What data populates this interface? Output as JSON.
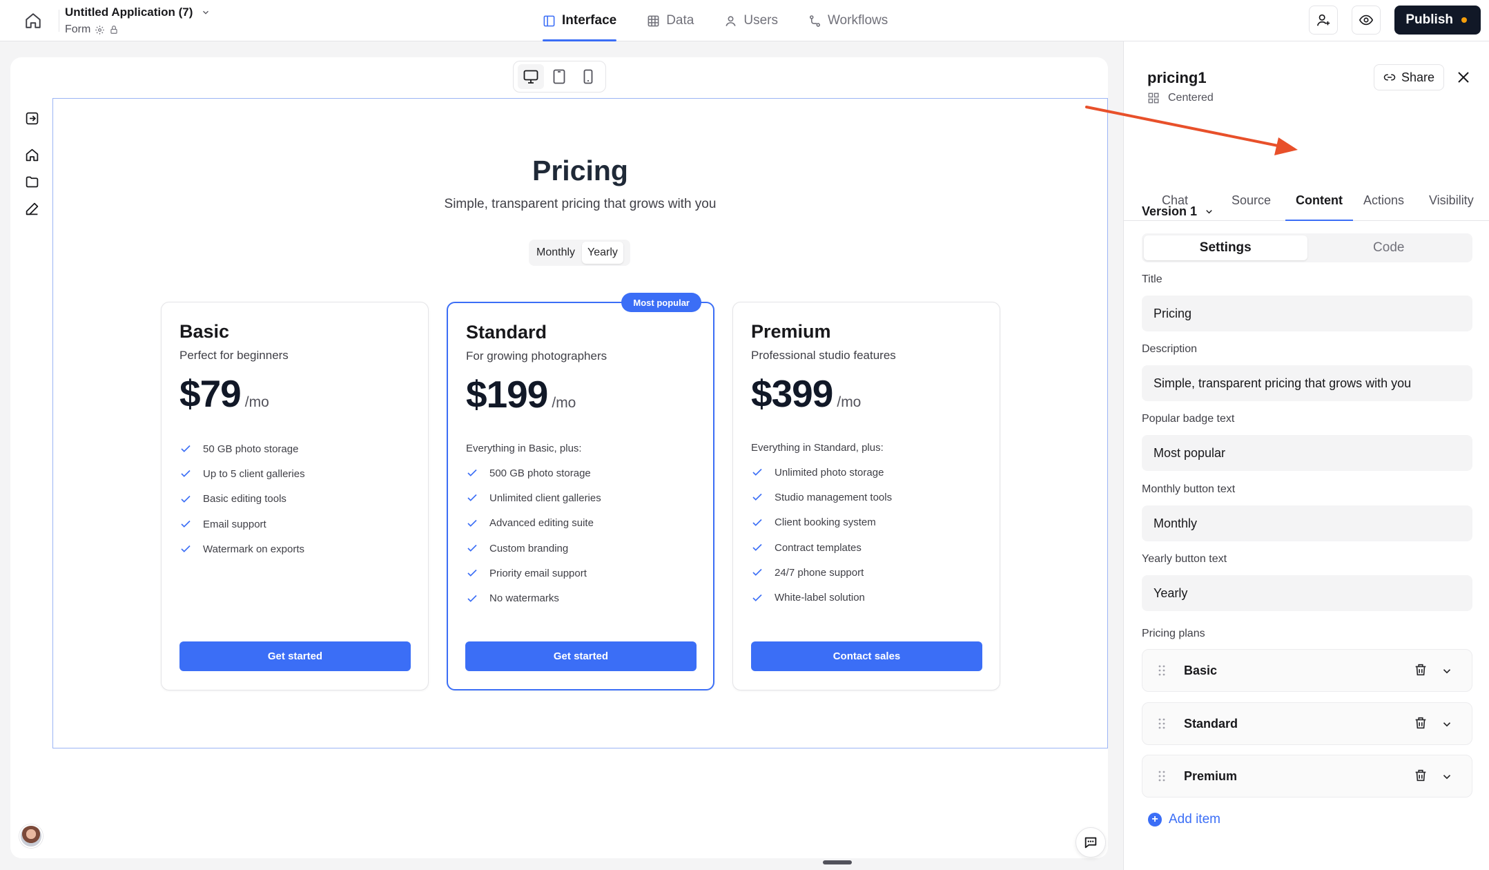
{
  "app": {
    "title": "Untitled Application (7)",
    "subtitle": "Form"
  },
  "nav": {
    "tabs": [
      {
        "label": "Interface",
        "icon": "layout-icon",
        "active": true
      },
      {
        "label": "Data",
        "icon": "table-icon",
        "active": false
      },
      {
        "label": "Users",
        "icon": "user-icon",
        "active": false
      },
      {
        "label": "Workflows",
        "icon": "workflow-icon",
        "active": false
      }
    ]
  },
  "toolbar": {
    "publish_label": "Publish",
    "publish_status_color": "#f59e0b"
  },
  "preview": {
    "devices": [
      "desktop",
      "tablet",
      "mobile"
    ],
    "active_device": "desktop"
  },
  "pricing": {
    "title": "Pricing",
    "description": "Simple, transparent pricing that grows with you",
    "toggle": {
      "monthly": "Monthly",
      "yearly": "Yearly",
      "active": "yearly"
    },
    "plans": [
      {
        "name": "Basic",
        "tagline": "Perfect for beginners",
        "price": "$79",
        "period": "/mo",
        "intro": "",
        "popular": false,
        "features": [
          "50 GB photo storage",
          "Up to 5 client galleries",
          "Basic editing tools",
          "Email support",
          "Watermark on exports"
        ],
        "cta": "Get started"
      },
      {
        "name": "Standard",
        "tagline": "For growing photographers",
        "price": "$199",
        "period": "/mo",
        "intro": "Everything in Basic, plus:",
        "popular": true,
        "badge": "Most popular",
        "features": [
          "500 GB photo storage",
          "Unlimited client galleries",
          "Advanced editing suite",
          "Custom branding",
          "Priority email support",
          "No watermarks"
        ],
        "cta": "Get started"
      },
      {
        "name": "Premium",
        "tagline": "Professional studio features",
        "price": "$399",
        "period": "/mo",
        "intro": "Everything in Standard, plus:",
        "popular": false,
        "features": [
          "Unlimited photo storage",
          "Studio management tools",
          "Client booking system",
          "Contract templates",
          "24/7 phone support",
          "White-label solution"
        ],
        "cta": "Contact sales"
      }
    ]
  },
  "panel": {
    "component_name": "pricing1",
    "layout_label": "Centered",
    "share_label": "Share",
    "tabs": [
      "Chat",
      "Source",
      "Content",
      "Actions",
      "Visibility"
    ],
    "active_tab": "Content",
    "version_label": "Version 1",
    "segments": [
      "Settings",
      "Code"
    ],
    "active_segment": "Settings",
    "fields": [
      {
        "label": "Title",
        "value": "Pricing"
      },
      {
        "label": "Description",
        "value": "Simple, transparent pricing that grows with you"
      },
      {
        "label": "Popular badge text",
        "value": "Most popular"
      },
      {
        "label": "Monthly button text",
        "value": "Monthly"
      },
      {
        "label": "Yearly button text",
        "value": "Yearly"
      }
    ],
    "plans_label": "Pricing plans",
    "plans": [
      "Basic",
      "Standard",
      "Premium"
    ],
    "add_item_label": "Add item"
  },
  "colors": {
    "accent": "#3b6ef6",
    "annotation_arrow": "#e8502a",
    "publish_bg": "#111827"
  }
}
